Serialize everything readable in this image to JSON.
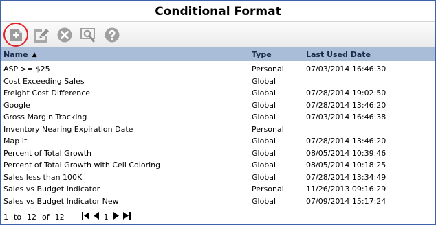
{
  "window": {
    "title": "Conditional Format"
  },
  "toolbar": {
    "buttons": [
      {
        "name": "add",
        "icon": "add-document-icon"
      },
      {
        "name": "edit",
        "icon": "pencil-icon"
      },
      {
        "name": "delete",
        "icon": "close-icon"
      },
      {
        "name": "inspect",
        "icon": "search-icon"
      },
      {
        "name": "help",
        "icon": "help-icon"
      }
    ],
    "highlight_color": "#e0242a"
  },
  "table": {
    "columns": [
      {
        "key": "name",
        "label": "Name",
        "sorted": "ascending"
      },
      {
        "key": "type",
        "label": "Type"
      },
      {
        "key": "date",
        "label": "Last Used Date"
      }
    ],
    "rows": [
      {
        "name": "ASP >= $25",
        "type": "Personal",
        "date": "07/03/2014 16:46:30"
      },
      {
        "name": "Cost Exceeding Sales",
        "type": "Global",
        "date": ""
      },
      {
        "name": "Freight Cost Difference",
        "type": "Global",
        "date": "07/28/2014 19:02:50"
      },
      {
        "name": "Google",
        "type": "Global",
        "date": "07/28/2014 13:46:20"
      },
      {
        "name": "Gross Margin Tracking",
        "type": "Global",
        "date": "07/03/2014 16:46:38"
      },
      {
        "name": "Inventory Nearing Expiration Date",
        "type": "Personal",
        "date": ""
      },
      {
        "name": "Map It",
        "type": "Global",
        "date": "07/28/2014 13:46:20"
      },
      {
        "name": "Percent of Total Growth",
        "type": "Global",
        "date": "08/05/2014 10:39:46"
      },
      {
        "name": "Percent of Total Growth with Cell Coloring",
        "type": "Global",
        "date": "08/05/2014 10:18:25"
      },
      {
        "name": "Sales less than 100K",
        "type": "Global",
        "date": "07/28/2014 13:34:49"
      },
      {
        "name": "Sales vs Budget Indicator",
        "type": "Personal",
        "date": "11/26/2013 09:16:29"
      },
      {
        "name": "Sales vs Budget Indicator New",
        "type": "Global",
        "date": "07/09/2014 15:17:24"
      }
    ]
  },
  "pager": {
    "from": "1",
    "to_label": "to",
    "to": "12",
    "of_label": "of",
    "total": "12",
    "current_page": "1"
  },
  "colors": {
    "border": "#3f63a6",
    "header_bg": "#a9bcd8",
    "icon_gray": "#a0a0a0"
  }
}
